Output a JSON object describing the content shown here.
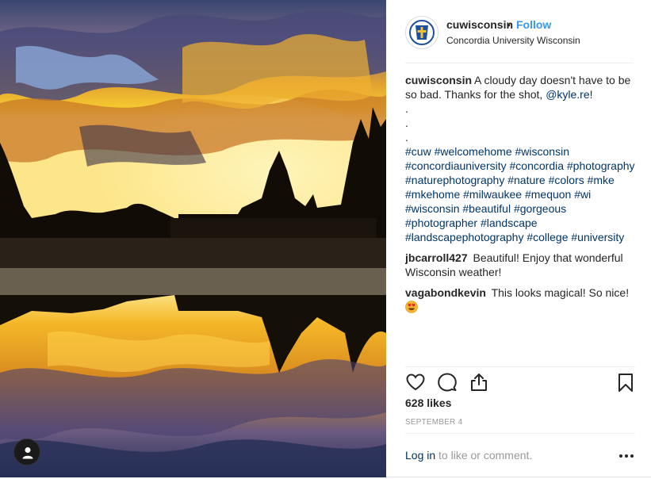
{
  "post": {
    "username": "cuwisconsin",
    "follow_separator": "•",
    "follow_label": "Follow",
    "location": "Concordia University Wisconsin",
    "avatar_icon": "concordia-logo-icon"
  },
  "caption": {
    "username": "cuwisconsin",
    "text": "A cloudy day doesn't have to be so bad. Thanks for the shot, ",
    "mention": "@kyle.re",
    "text_end": "!",
    "dots": [
      ".",
      ".",
      "."
    ],
    "hashtags": "#cuw #welcomehome #wisconsin #concordiauniversity #concordia #photography #naturephotography #nature #colors #mke #mkehome #milwaukee #mequon #wi #wisconsin #beautiful #gorgeous #photographer #landscape #landscapephotography #college #university"
  },
  "comments": [
    {
      "username": "jbcarroll427",
      "text": "Beautiful! Enjoy that wonderful Wisconsin weather!"
    },
    {
      "username": "vagabondkevin",
      "text": "This looks magical! So nice!",
      "emoji": "heart-eyes-emoji"
    }
  ],
  "actions": {
    "like_icon": "heart-icon",
    "comment_icon": "comment-bubble-icon",
    "share_icon": "share-icon",
    "save_icon": "bookmark-icon"
  },
  "likes": "628 likes",
  "date": "SEPTEMBER 4",
  "footer": {
    "login_link": "Log in",
    "login_rest": " to like or comment.",
    "more_icon": "more-options-icon"
  },
  "colors": {
    "link_blue": "#3897f0",
    "hashtag_navy": "#003569",
    "muted_gray": "#999999",
    "text_dark": "#262626"
  }
}
